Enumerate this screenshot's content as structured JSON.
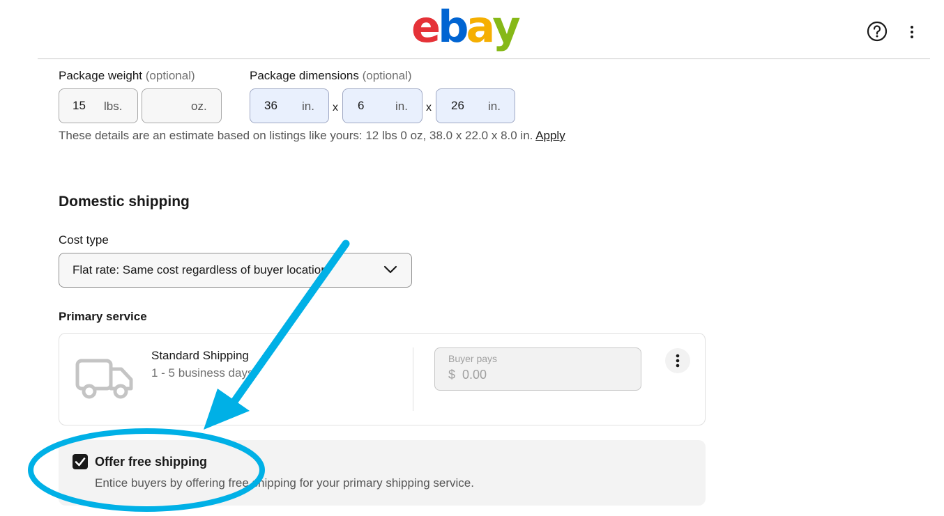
{
  "header": {
    "logo_letters": [
      "e",
      "b",
      "a",
      "y"
    ],
    "logo_colors": [
      "#e53238",
      "#0064d2",
      "#f5af02",
      "#86b817"
    ],
    "help_icon": "question-circle-icon",
    "more_icon": "more-vertical-icon"
  },
  "package": {
    "weight_label": "Package weight",
    "weight_optional": "(optional)",
    "weight_lbs_value": "15",
    "weight_lbs_unit": "lbs.",
    "weight_oz_value": "",
    "weight_oz_unit": "oz.",
    "dimensions_label": "Package dimensions",
    "dimensions_optional": "(optional)",
    "dim_length": "36",
    "dim_width": "6",
    "dim_height": "26",
    "dim_unit": "in.",
    "times_symbol": "x",
    "estimate_text": "These details are an estimate based on listings like yours: 12 lbs 0 oz, 38.0 x 22.0 x 8.0 in.",
    "apply_link": "Apply"
  },
  "domestic": {
    "heading": "Domestic shipping",
    "cost_type_label": "Cost type",
    "cost_type_value": "Flat rate: Same cost regardless of buyer location",
    "primary_service_label": "Primary service",
    "service_icon": "truck-icon",
    "service_name": "Standard Shipping",
    "service_days": "1 - 5 business days",
    "buyer_pays_label": "Buyer pays",
    "currency_symbol": "$",
    "buyer_pays_value": "0.00"
  },
  "free_shipping": {
    "checked": true,
    "label": "Offer free shipping",
    "description": "Entice buyers by offering free shipping for your primary shipping service."
  },
  "annotation": {
    "arrow_color": "#00b0e6",
    "circle_color": "#00b0e6"
  }
}
